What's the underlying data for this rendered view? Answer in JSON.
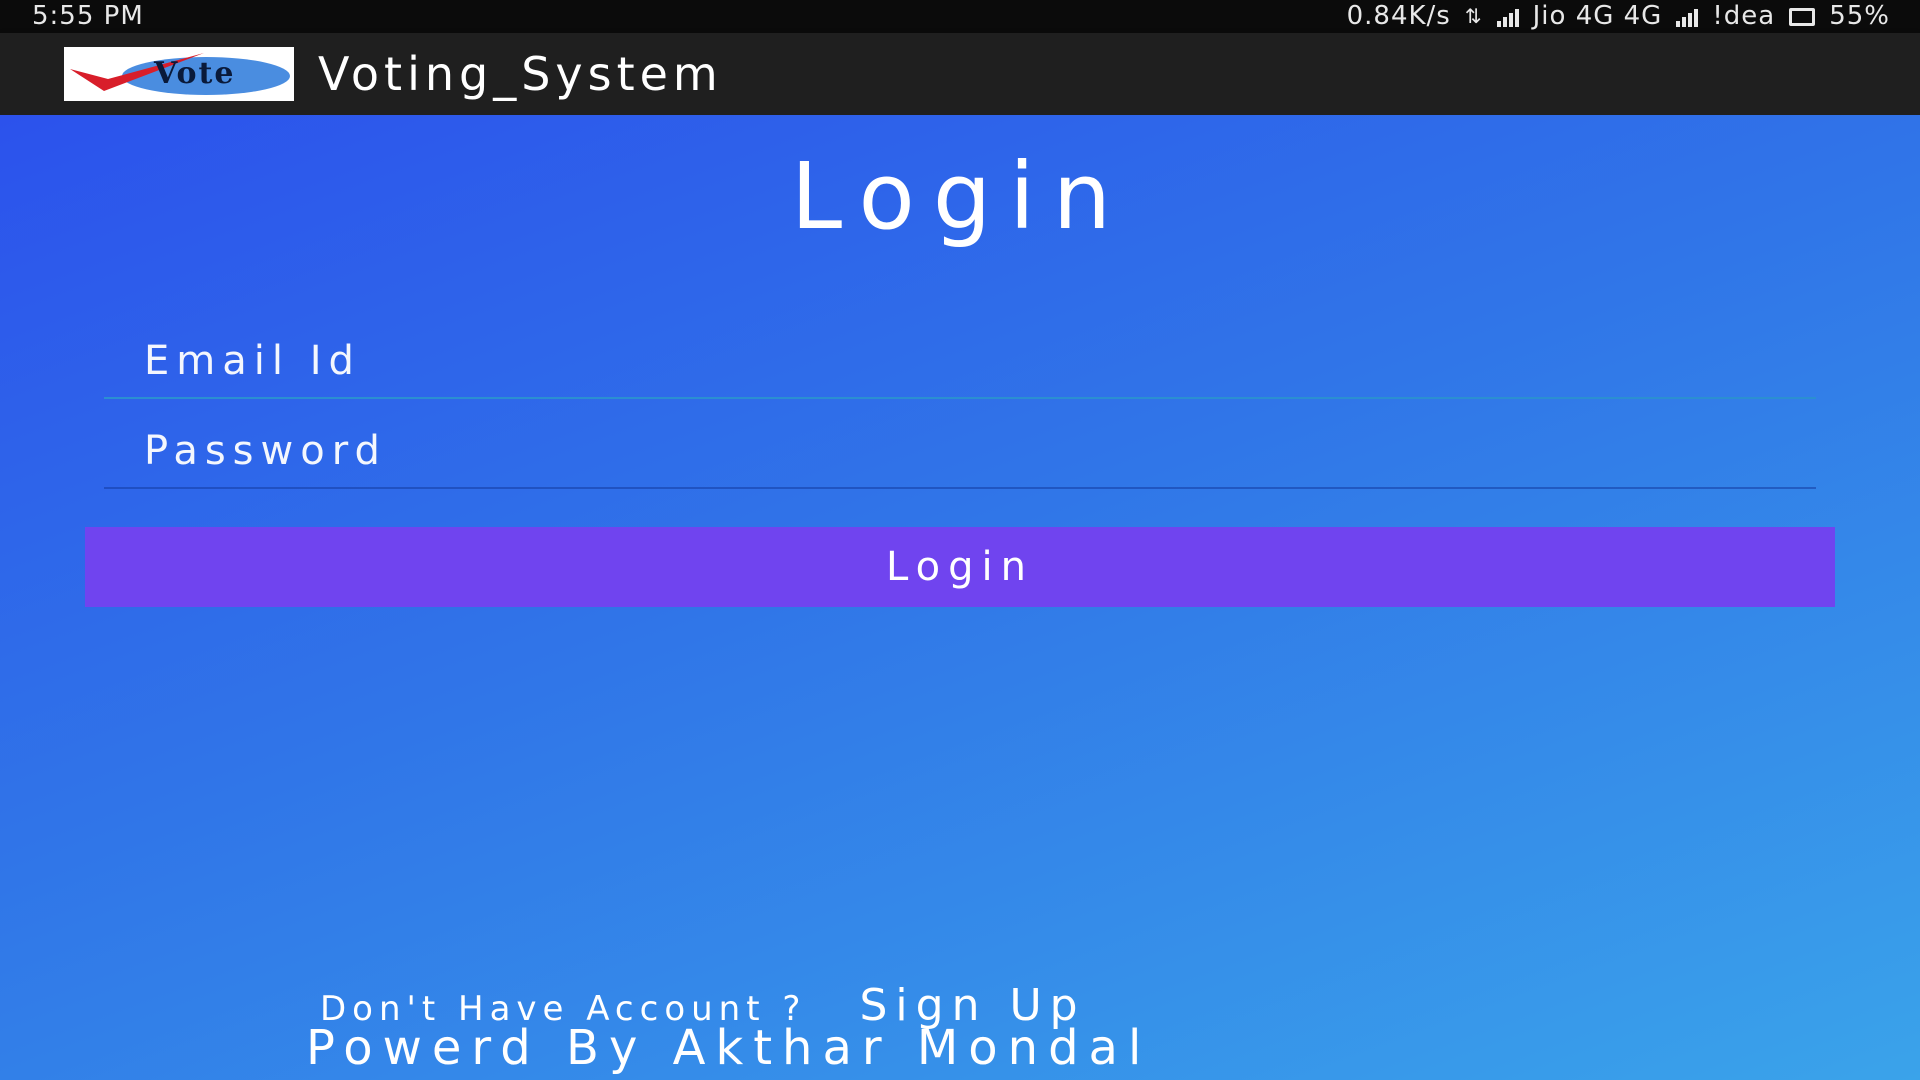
{
  "status_bar": {
    "time": "5:55 PM",
    "net_speed": "0.84K/s",
    "carrier1": "Jio 4G 4G",
    "carrier2": "!dea",
    "battery": "55%",
    "icons": [
      "data-transfer-icon",
      "signal-icon",
      "signal-icon",
      "battery-icon"
    ]
  },
  "app_bar": {
    "logo_text": "Vote",
    "title": "Voting_System"
  },
  "login": {
    "title": "Login",
    "email_placeholder": "Email Id",
    "password_placeholder": "Password",
    "button_label": "Login"
  },
  "footer": {
    "question": "Don't Have Account ?",
    "signup": "Sign Up",
    "powered": "Powerd By Akthar Mondal"
  },
  "colors": {
    "button": "#7044ef",
    "gradient_top": "#2c52ec",
    "gradient_bottom": "#3aa3ea",
    "app_bar": "#1f1f1f"
  }
}
